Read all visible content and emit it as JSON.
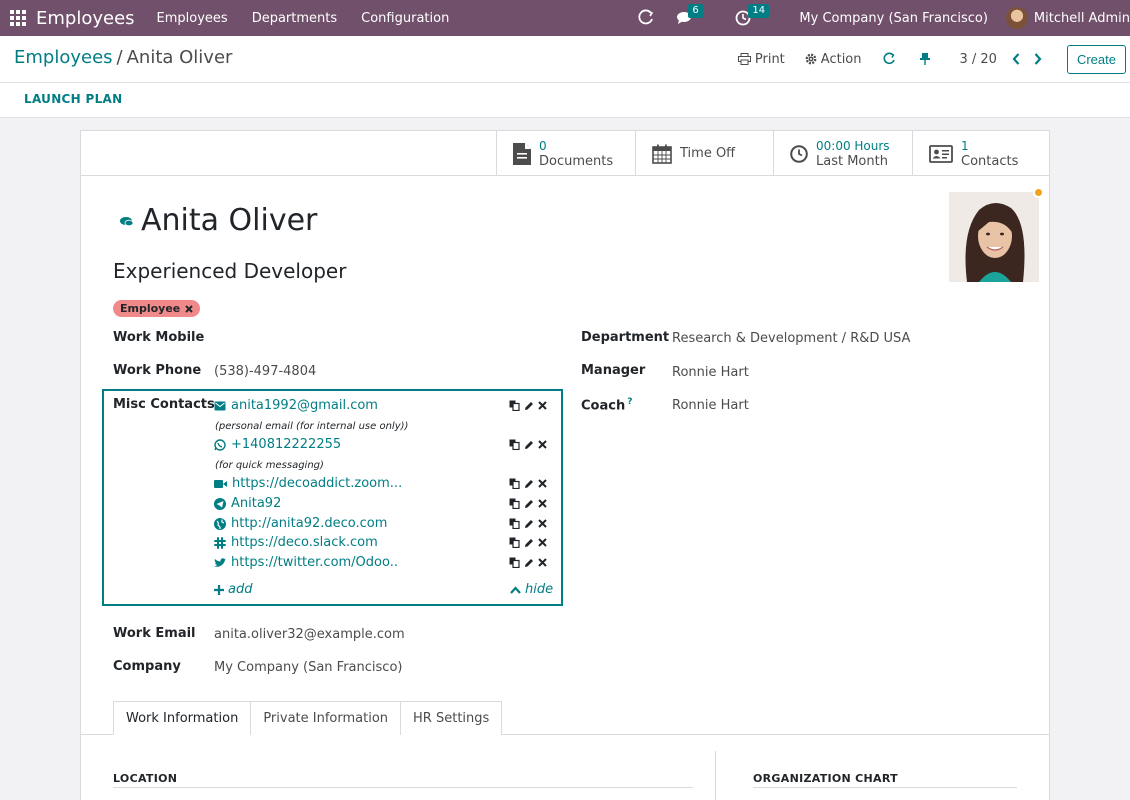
{
  "navbar": {
    "brand": "Employees",
    "menus": [
      "Employees",
      "Departments",
      "Configuration"
    ],
    "messages_count": "6",
    "activities_count": "14",
    "company": "My Company (San Francisco)",
    "user": "Mitchell Admin"
  },
  "breadcrumb": {
    "parent": "Employees",
    "separator": "/",
    "current": "Anita Oliver"
  },
  "control": {
    "print": "Print",
    "action": "Action",
    "pager": "3 / 20",
    "create": "Create"
  },
  "statusbar": {
    "launch_plan": "LAUNCH PLAN"
  },
  "smart_buttons": {
    "documents_value": "0",
    "documents_label": "Documents",
    "timeoff_label": "Time Off",
    "hours_value": "00:00 Hours",
    "hours_label": "Last Month",
    "contacts_value": "1",
    "contacts_label": "Contacts"
  },
  "employee": {
    "name": "Anita Oliver",
    "job_title": "Experienced Developer",
    "tag": "Employee",
    "work_mobile_label": "Work Mobile",
    "work_mobile": "",
    "work_phone_label": "Work Phone",
    "work_phone": "(538)-497-4804",
    "misc_contacts_label": "Misc Contacts",
    "work_email_label": "Work Email",
    "work_email": "anita.oliver32@example.com",
    "company_label": "Company",
    "company": "My Company (San Francisco)",
    "department_label": "Department",
    "department": "Research & Development / R&D USA",
    "manager_label": "Manager",
    "manager": "Ronnie Hart",
    "coach_label": "Coach",
    "coach_help": "?",
    "coach": "Ronnie Hart"
  },
  "misc_contacts": {
    "email": "anita1992@gmail.com",
    "email_note": "(personal email (for internal use only))",
    "whatsapp": "+140812222255",
    "whatsapp_note": "(for quick messaging)",
    "zoom": "https://decoaddict.zoom...",
    "telegram": "Anita92",
    "website": "http://anita92.deco.com",
    "slack": "https://deco.slack.com",
    "twitter": "https://twitter.com/Odoo..",
    "add": "add",
    "hide": "hide"
  },
  "tabs": [
    "Work Information",
    "Private Information",
    "HR Settings"
  ],
  "sections": {
    "location": "LOCATION",
    "org_chart": "ORGANIZATION CHART"
  },
  "colors": {
    "navbar": "#71506b",
    "accent": "#017e84",
    "tag": "#f08a8a",
    "status": "#f3a21c"
  }
}
